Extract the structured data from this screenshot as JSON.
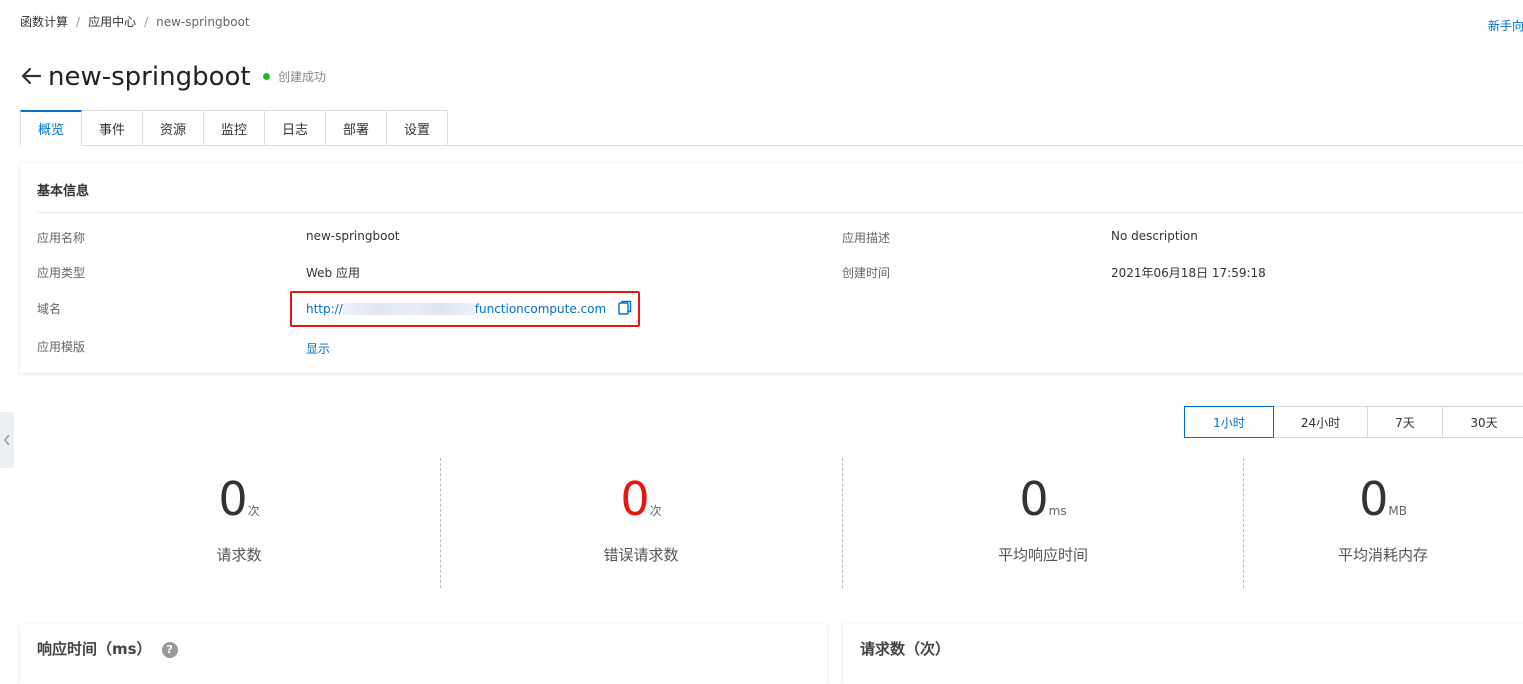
{
  "breadcrumb": [
    "函数计算",
    "应用中心",
    "new-springboot"
  ],
  "breadcrumb_sep": "/",
  "guide_link": "新手向",
  "header": {
    "title": "new-springboot",
    "status": "创建成功",
    "status_color": "#1bb934"
  },
  "tabs": [
    "概览",
    "事件",
    "资源",
    "监控",
    "日志",
    "部署",
    "设置"
  ],
  "basic_info": {
    "title": "基本信息",
    "app_name_label": "应用名称",
    "app_name": "new-springboot",
    "app_desc_label": "应用描述",
    "app_desc": "No description",
    "app_type_label": "应用类型",
    "app_type": "Web 应用",
    "created_label": "创建时间",
    "created": "2021年06月18日 17:59:18",
    "domain_label": "域名",
    "domain_prefix": "http://",
    "domain_suffix": "functioncompute.com",
    "template_label": "应用模版",
    "template_action": "显示"
  },
  "time_range": [
    "1小时",
    "24小时",
    "7天",
    "30天"
  ],
  "stats": [
    {
      "value": "0",
      "unit": "次",
      "label": "请求数"
    },
    {
      "value": "0",
      "unit": "次",
      "label": "错误请求数"
    },
    {
      "value": "0",
      "unit": "ms",
      "label": "平均响应时间"
    },
    {
      "value": "0",
      "unit": "MB",
      "label": "平均消耗内存"
    }
  ],
  "panels": {
    "response_time": "响应时间（ms）",
    "requests": "请求数（次）"
  },
  "colors": {
    "accent": "#0070cc",
    "error": "#e8160f",
    "highlight_box": "#e8160f"
  }
}
